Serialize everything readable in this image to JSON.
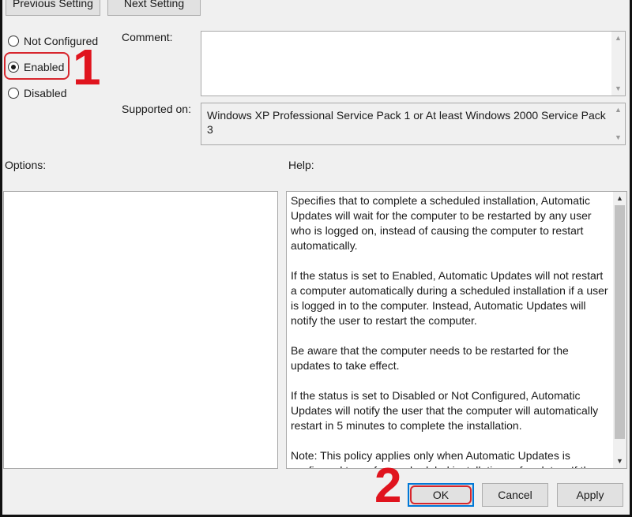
{
  "nav": {
    "previous_label": "Previous Setting",
    "next_label": "Next Setting"
  },
  "state": {
    "options": [
      {
        "label": "Not Configured",
        "checked": false
      },
      {
        "label": "Enabled",
        "checked": true
      },
      {
        "label": "Disabled",
        "checked": false
      }
    ]
  },
  "comment": {
    "label": "Comment:",
    "value": ""
  },
  "supported": {
    "label": "Supported on:",
    "value": "Windows XP Professional Service Pack 1 or At least Windows 2000 Service Pack 3"
  },
  "options_panel": {
    "label": "Options:"
  },
  "help": {
    "label": "Help:",
    "paragraphs": [
      "Specifies that to complete a scheduled installation, Automatic Updates will wait for the computer to be restarted by any user who is logged on, instead of causing the computer to restart automatically.",
      "If the status is set to Enabled, Automatic Updates will not restart a computer automatically during a scheduled installation if a user is logged in to the computer. Instead, Automatic Updates will notify the user to restart the computer.",
      "Be aware that the computer needs to be restarted for the updates to take effect.",
      "If the status is set to Disabled or Not Configured, Automatic Updates will notify the user that the computer will automatically restart in 5 minutes to complete the installation.",
      "Note: This policy applies only when Automatic Updates is configured to perform scheduled installations of updates. If the"
    ]
  },
  "buttons": {
    "ok": "OK",
    "cancel": "Cancel",
    "apply": "Apply"
  },
  "annotations": {
    "step1": "1",
    "step2": "2"
  },
  "colors": {
    "annotation": "#e0141e",
    "focus": "#0078d7"
  }
}
